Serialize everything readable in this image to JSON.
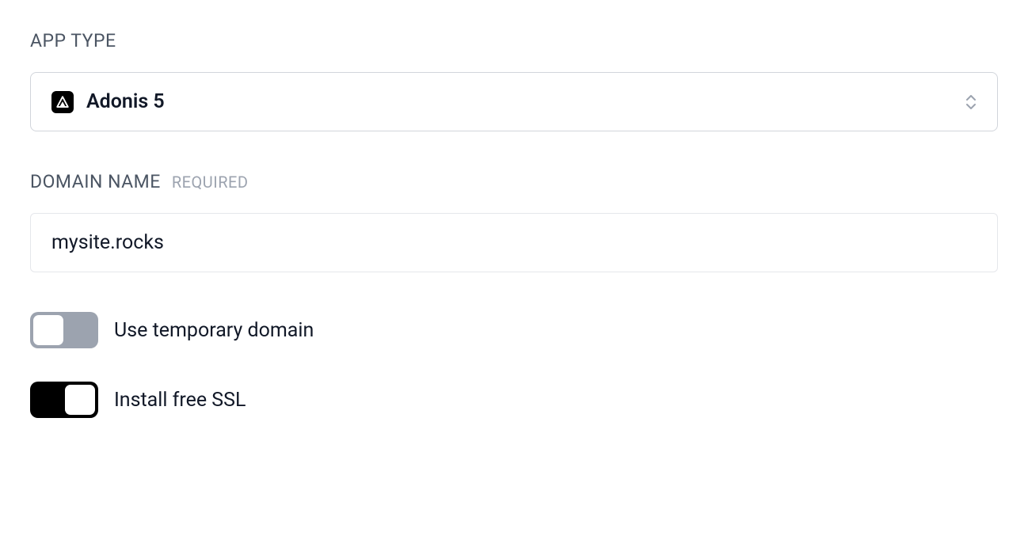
{
  "appType": {
    "label": "APP TYPE",
    "selected": "Adonis 5",
    "iconName": "adonis-icon"
  },
  "domainName": {
    "label": "DOMAIN NAME",
    "requiredBadge": "REQUIRED",
    "value": "mysite.rocks"
  },
  "toggles": {
    "temporaryDomain": {
      "label": "Use temporary domain",
      "enabled": false
    },
    "installSSL": {
      "label": "Install free SSL",
      "enabled": true
    }
  }
}
